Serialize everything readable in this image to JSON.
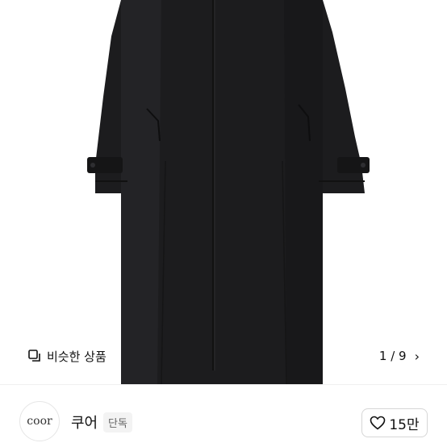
{
  "similar_products": {
    "icon": "similar-products-icon",
    "label": "비슷한 상품"
  },
  "gallery": {
    "current": 1,
    "total": 9,
    "counter_label": "1 / 9",
    "next_icon": "chevron-right-icon"
  },
  "store": {
    "logo_text": "coor",
    "name": "쿠어",
    "badge": "단독"
  },
  "like": {
    "icon": "heart-icon",
    "count_label": "15만"
  },
  "colors": {
    "coat": "#1c1c1e",
    "background": "#ffffff"
  }
}
